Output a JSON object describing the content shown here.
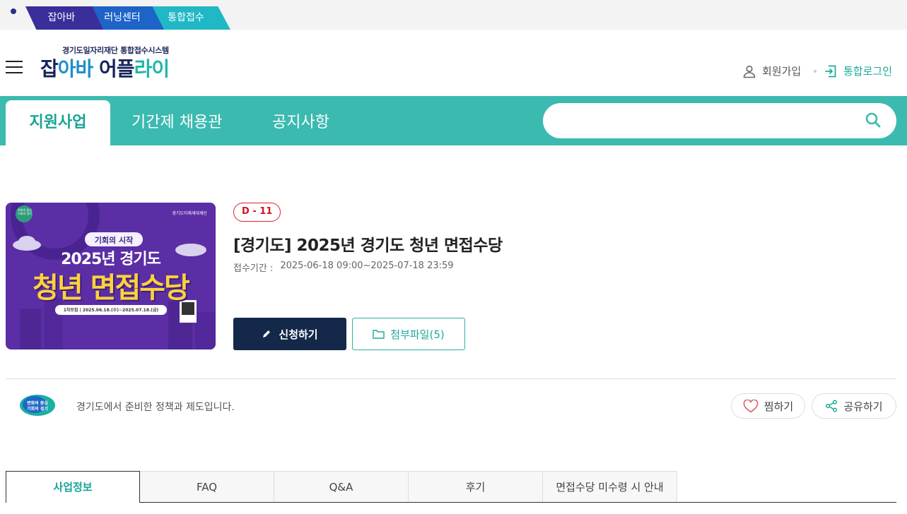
{
  "site_tabs": [
    "잡아바",
    "러닝센터",
    "통합접수"
  ],
  "header": {
    "logo_subtitle": "경기도일자리재단 통합접수시스템",
    "logo_part1": "잡",
    "logo_part2": "아바",
    "logo_part3": " 어플",
    "logo_part4": "라이",
    "join_label": "회원가입",
    "login_label": "통합로그인"
  },
  "nav": {
    "tabs": [
      "지원사업",
      "기간제 채용관",
      "공지사항"
    ],
    "search_placeholder": ""
  },
  "program": {
    "poster_texts": {
      "org": "경기도미래세대재단",
      "badge": "변화의 중심 기회의 경기",
      "line1": "기회의 시작",
      "line2": "2025년 경기도",
      "line3": "청년 면접수당",
      "line4": "1차모집 | 2025.06.18.(수)~2025.07.18.(금)"
    },
    "dday": "D - 11",
    "title": "[경기도] 2025년 경기도 청년 면접수당",
    "period_label": "접수기간 :",
    "period_value": "2025-06-18 09:00~2025-07-18 23:59",
    "apply_label": "신청하기",
    "attach_label": "첨부파일(5)"
  },
  "org": {
    "logo_text1": "변화의 중심",
    "logo_text2": "기회의 경기",
    "desc": "경기도에서 준비한 정책과 제도입니다.",
    "like_label": "찜하기",
    "share_label": "공유하기"
  },
  "bottom_tabs": [
    "사업정보",
    "FAQ",
    "Q&A",
    "후기",
    "면접수당 미수령 시 안내"
  ],
  "colors": {
    "teal": "#3bbab0",
    "navy": "#14294a",
    "red": "#e0202c",
    "purple": "#5b2ea6"
  }
}
